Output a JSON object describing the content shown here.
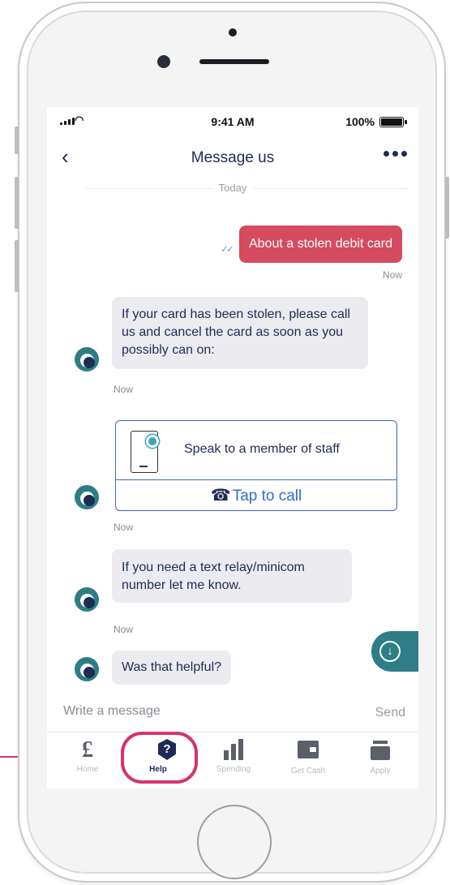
{
  "status_bar": {
    "time": "9:41 AM",
    "battery": "100%"
  },
  "header": {
    "title": "Message us"
  },
  "date_separator": "Today",
  "messages": [
    {
      "from": "user",
      "text": "About a stolen debit card",
      "time": "Now"
    },
    {
      "from": "agent",
      "text": "If your card has been stolen, please call us and cancel the card as soon as you possibly can on:",
      "time": "Now"
    },
    {
      "from": "agent",
      "card_title": "Speak to a member of staff",
      "action_label": "Tap to call",
      "time": "Now"
    },
    {
      "from": "agent",
      "text": "If you need a text relay/minicom number let me know.",
      "time": "Now"
    },
    {
      "from": "agent",
      "text": "Was that helpful?"
    }
  ],
  "composer": {
    "placeholder": "Write a message",
    "send_label": "Send"
  },
  "tabs": [
    {
      "label": "Home",
      "icon": "pound-icon"
    },
    {
      "label": "Help",
      "icon": "help-shield-icon",
      "active": true
    },
    {
      "label": "Spending",
      "icon": "bar-chart-icon"
    },
    {
      "label": "Get Cash",
      "icon": "wallet-icon"
    },
    {
      "label": "Apply",
      "icon": "tray-icon"
    }
  ],
  "colors": {
    "brand_navy": "#1f2a55",
    "outgoing_bubble": "#d54b5f",
    "teal": "#2f7d87",
    "highlight": "#d6336c"
  }
}
